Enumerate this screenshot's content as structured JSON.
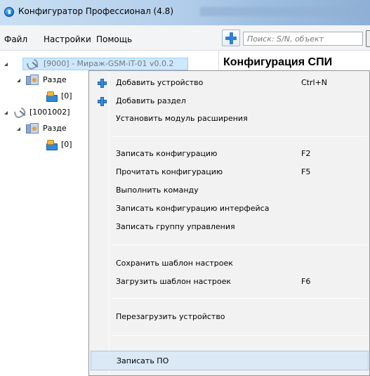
{
  "window": {
    "title": "Конфигуратор Профессионал (4.8)"
  },
  "menubar": {
    "items": [
      "Файл",
      "Настройки",
      "Помощь"
    ]
  },
  "search": {
    "placeholder": "Поиск: S/N, объект"
  },
  "tree": {
    "nodes": [
      {
        "label": "[9000] - Мираж-GSM-iT-01 v0.0.2",
        "icon": "device-icon",
        "selected": true
      },
      {
        "label": "Разде",
        "icon": "section-icon"
      },
      {
        "label": "[0]",
        "icon": "zone-icon"
      },
      {
        "label": "[1001002]",
        "icon": "device-icon"
      },
      {
        "label": "Разде",
        "icon": "section-icon"
      },
      {
        "label": "[0]",
        "icon": "zone-icon"
      }
    ]
  },
  "panel": {
    "title": "Конфигурация СПИ"
  },
  "context_menu": {
    "items": [
      {
        "label": "Добавить устройство",
        "shortcut": "Ctrl+N",
        "icon": "plus-icon"
      },
      {
        "label": "Добавить раздел",
        "shortcut": "",
        "icon": "plus-icon"
      },
      {
        "label": "Установить модуль расширения",
        "shortcut": ""
      },
      {
        "label": "Записать конфигурацию",
        "shortcut": "F2"
      },
      {
        "label": "Прочитать конфигурацию",
        "shortcut": "F5"
      },
      {
        "label": "Выполнить команду",
        "shortcut": ""
      },
      {
        "label": "Записать конфигурацию интерфейса",
        "shortcut": ""
      },
      {
        "label": "Записать группу управления",
        "shortcut": ""
      },
      {
        "label": "Сохранить шаблон настроек",
        "shortcut": ""
      },
      {
        "label": "Загрузить шаблон настроек",
        "shortcut": "F6"
      },
      {
        "label": "Перезагрузить устройство",
        "shortcut": ""
      },
      {
        "label": "Записать ПО",
        "shortcut": "",
        "highlighted": true
      }
    ]
  },
  "colors": {
    "accent": "#2f7fd3",
    "selection": "#cde8ff",
    "menu_hover": "#dbe8f6"
  }
}
